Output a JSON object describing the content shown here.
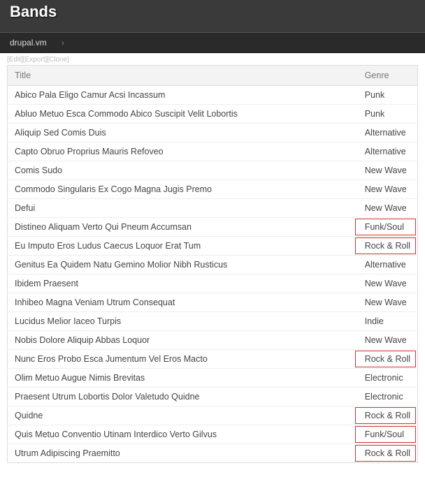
{
  "page": {
    "title": "Bands"
  },
  "breadcrumb": {
    "home": "drupal.vm"
  },
  "mini_links": {
    "edit": "[Edit]",
    "export": "[Export]",
    "clone": "[Clone]"
  },
  "table": {
    "headers": {
      "title": "Title",
      "genre": "Genre"
    },
    "rows": [
      {
        "title": "Abico Pala Eligo Camur Acsi Incassum",
        "genre": "Punk",
        "hl": false
      },
      {
        "title": "Abluo Metuo Esca Commodo Abico Suscipit Velit Lobortis",
        "genre": "Punk",
        "hl": false
      },
      {
        "title": "Aliquip Sed Comis Duis",
        "genre": "Alternative",
        "hl": false
      },
      {
        "title": "Capto Obruo Proprius Mauris Refoveo",
        "genre": "Alternative",
        "hl": false
      },
      {
        "title": "Comis Sudo",
        "genre": "New Wave",
        "hl": false
      },
      {
        "title": "Commodo Singularis Ex Cogo Magna Jugis Premo",
        "genre": "New Wave",
        "hl": false
      },
      {
        "title": "Defui",
        "genre": "New Wave",
        "hl": false
      },
      {
        "title": "Distineo Aliquam Verto Qui Pneum Accumsan",
        "genre": "Funk/Soul",
        "hl": true
      },
      {
        "title": "Eu Imputo Eros Ludus Caecus Loquor Erat Tum",
        "genre": "Rock & Roll",
        "hl": true
      },
      {
        "title": "Genitus Ea Quidem Natu Gemino Molior Nibh Rusticus",
        "genre": "Alternative",
        "hl": false
      },
      {
        "title": "Ibidem Praesent",
        "genre": "New Wave",
        "hl": false
      },
      {
        "title": "Inhibeo Magna Veniam Utrum Consequat",
        "genre": "New Wave",
        "hl": false
      },
      {
        "title": "Lucidus Melior Iaceo Turpis",
        "genre": "Indie",
        "hl": false
      },
      {
        "title": "Nobis Dolore Aliquip Abbas Loquor",
        "genre": "New Wave",
        "hl": false
      },
      {
        "title": "Nunc Eros Probo Esca Jumentum Vel Eros Macto",
        "genre": "Rock & Roll",
        "hl": true
      },
      {
        "title": "Olim Metuo Augue Nimis Brevitas",
        "genre": "Electronic",
        "hl": false
      },
      {
        "title": "Praesent Utrum Lobortis Dolor Valetudo Quidne",
        "genre": "Electronic",
        "hl": false
      },
      {
        "title": "Quidne",
        "genre": "Rock & Roll",
        "hl": true
      },
      {
        "title": "Quis Metuo Conventio Utinam Interdico Verto Gilvus",
        "genre": "Funk/Soul",
        "hl": true
      },
      {
        "title": "Utrum Adipiscing Praemitto",
        "genre": "Rock & Roll",
        "hl": true
      }
    ]
  }
}
